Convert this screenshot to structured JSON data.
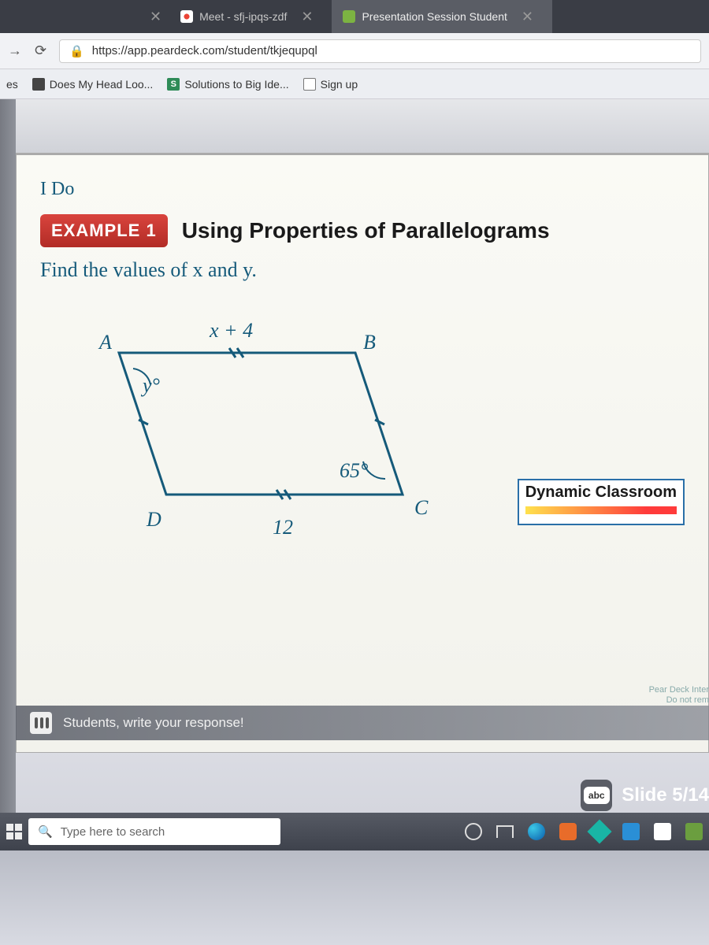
{
  "tabs": {
    "meet": "Meet - sfj-ipqs-zdf",
    "pear": "Presentation Session Student"
  },
  "url": "https://app.peardeck.com/student/tkjequpql",
  "bookmarks": {
    "partial": "es",
    "head": "Does My Head Loo...",
    "solutions": "Solutions to Big Ide...",
    "signup": "Sign up"
  },
  "slide": {
    "section": "I Do",
    "badge": "EXAMPLE 1",
    "heading": "Using Properties of Parallelograms",
    "instruction": "Find the values of x and y.",
    "vertices": {
      "A": "A",
      "B": "B",
      "C": "C",
      "D": "D"
    },
    "labels": {
      "top": "x + 4",
      "angleA": "y°",
      "angleC": "65°",
      "bottom": "12"
    },
    "dynamic": "Dynamic Classroom",
    "prompt": "Students, write your response!",
    "pearnote1": "Pear Deck Inter",
    "pearnote2": "Do not rem"
  },
  "counter": {
    "abc": "abc",
    "text": "Slide 5/14"
  },
  "taskbar": {
    "search": "Type here to search"
  }
}
